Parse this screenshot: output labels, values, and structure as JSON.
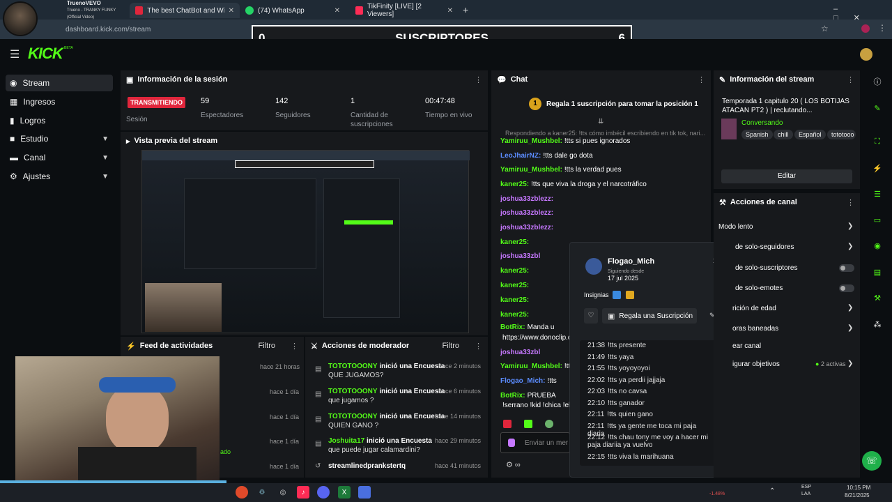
{
  "browser": {
    "tabs": [
      {
        "label": "TruenoVEVO",
        "sub": "Trueno - TRANKY FUNKY (Official Video)"
      },
      {
        "label": "The best ChatBot and Widgets"
      },
      {
        "label": "(74) WhatsApp"
      },
      {
        "label": "TikFinity [LIVE] [2 Viewers]"
      }
    ],
    "url": "dashboard.kick.com/stream"
  },
  "overlay": {
    "left": "0",
    "title": "SUSCRIPTORES",
    "right": "6"
  },
  "kick": {
    "logo": "KICK",
    "beta": "BETA"
  },
  "sidebar": {
    "items": [
      {
        "label": "Stream"
      },
      {
        "label": "Ingresos"
      },
      {
        "label": "Logros"
      },
      {
        "label": "Estudio"
      },
      {
        "label": "Canal"
      },
      {
        "label": "Ajustes"
      }
    ]
  },
  "session": {
    "title": "Información de la sesión",
    "live_badge": "TRANSMITIENDO",
    "session_label": "Sesión",
    "stats": [
      {
        "value": "59",
        "label": "Espectadores"
      },
      {
        "value": "142",
        "label": "Seguidores"
      },
      {
        "value": "1",
        "label": "Cantidad de suscripciones"
      },
      {
        "value": "00:47:48",
        "label": "Tiempo en vivo"
      }
    ]
  },
  "preview": {
    "title": "Vista previa del stream"
  },
  "feed": {
    "title": "Feed de actividades",
    "filter": "Filtro",
    "times": [
      "hace 21 horas",
      "hace 1 día",
      "hace 1 día",
      "hace 1 día",
      "hace 1 día"
    ],
    "partial": "ado"
  },
  "mod": {
    "title": "Acciones de moderador",
    "filter": "Filtro",
    "rows": [
      {
        "user": "TOTOTOOONY",
        "action": "inició una Encuesta",
        "sub": "QUE JUGAMOS?",
        "time": "hace 2 minutos"
      },
      {
        "user": "TOTOTOOONY",
        "action": "inició una Encuesta",
        "sub": "que jugamos ?",
        "time": "hace 6 minutos"
      },
      {
        "user": "TOTOTOOONY",
        "action": "inició una Encuesta",
        "sub": "QUIEN GANO ?",
        "time": "hace 14 minutos"
      },
      {
        "user": "Joshuita17",
        "action": "inició una Encuesta",
        "sub": "que puede jugar calamardini?",
        "time": "hace 29 minutos"
      },
      {
        "user": "streamlinedprankstertq",
        "action": "",
        "sub": "",
        "time": "hace 41 minutos"
      }
    ]
  },
  "chat": {
    "title": "Chat",
    "pinned": "Regala 1 suscripción para tomar la posición 1",
    "pinned_num": "1",
    "reply": "Respondiendo a kaner25: !tts cómo imbécil escribiendo en tik tok, nari...",
    "messages": [
      {
        "user": "Yamiruu_Mushbel:",
        "text": "!tts si pues ignorados",
        "color": "#53fc18"
      },
      {
        "user": "LeoJhairNZ:",
        "text": "!tts dale go dota",
        "color": "#5b8cff"
      },
      {
        "user": "Yamiruu_Mushbel:",
        "text": "!tts la verdad pues",
        "color": "#53fc18"
      },
      {
        "user": "kaner25:",
        "text": "!tts que viva la droga y el narcotráfico",
        "color": "#53fc18"
      },
      {
        "user": "joshua33zblezz:",
        "text": "",
        "color": "#c678ff"
      },
      {
        "user": "joshua33zblezz:",
        "text": "",
        "color": "#c678ff"
      },
      {
        "user": "joshua33zblezz:",
        "text": "",
        "color": "#c678ff"
      },
      {
        "user": "kaner25:",
        "text": "",
        "color": "#53fc18"
      },
      {
        "user": "joshua33zbl",
        "text": "",
        "color": "#c678ff"
      },
      {
        "user": "kaner25:",
        "text": "",
        "color": "#53fc18"
      },
      {
        "user": "kaner25:",
        "text": "",
        "color": "#53fc18"
      },
      {
        "user": "kaner25:",
        "text": "",
        "color": "#53fc18"
      },
      {
        "user": "kaner25:",
        "text": "",
        "color": "#53fc18"
      },
      {
        "user": "BotRix:",
        "text": "Manda u",
        "color": "#53fc18"
      },
      {
        "user": "",
        "text": "https://www.donoclip.c",
        "color": "#ffffff"
      },
      {
        "user": "joshua33zbl",
        "text": "",
        "color": "#c678ff"
      },
      {
        "user": "Yamiruu_Mushbel:",
        "text": "!tts y",
        "color": "#53fc18"
      },
      {
        "user": "Flogao_Mich:",
        "text": "!tts",
        "color": "#5b8cff"
      },
      {
        "user": "BotRix:",
        "text": "PRUEBA",
        "color": "#53fc18"
      },
      {
        "user": "",
        "text": "!serrano !kid !chica !el",
        "color": "#ffffff"
      }
    ],
    "input_placeholder": "Enviar un mensaje"
  },
  "popup": {
    "name": "Flogao_Mich",
    "following_label": "Siguiendo desde",
    "following_date": "17 jul 2025",
    "badges_label": "Insignias",
    "gift_button": "Regala una Suscripción",
    "history": [
      {
        "time": "21:38",
        "text": "!tts presente"
      },
      {
        "time": "21:49",
        "text": "!tts yaya"
      },
      {
        "time": "21:55",
        "text": "!tts yoyoyoyoi"
      },
      {
        "time": "22:02",
        "text": "!tts ya perdii jajjaja"
      },
      {
        "time": "22:03",
        "text": "!tts no cavsa"
      },
      {
        "time": "22:10",
        "text": "!tts ganador"
      },
      {
        "time": "22:11",
        "text": "!tts quien gano"
      },
      {
        "time": "22:11",
        "text": "!tts ya gente me toca mi paja diaria"
      },
      {
        "time": "22:12",
        "text": "!tts chau tony me voy a hacer mi paja diariia ya vuelvo"
      },
      {
        "time": "22:15",
        "text": "!tts viva la marihuana"
      }
    ]
  },
  "stream_info": {
    "title": "Información del stream",
    "stream_title": "Temporada 1 capitulo 20 ( LOS BOTIJAS ATACAN PT2 ) | reclutando...",
    "category": "Conversando",
    "tags": [
      "Spanish",
      "chill",
      "Español",
      "tototooo"
    ],
    "edit": "Editar"
  },
  "channel_actions": {
    "title": "Acciones de canal",
    "items": [
      {
        "label": "Modo lento"
      },
      {
        "label": "de solo-seguidores"
      },
      {
        "label": "de solo-suscriptores"
      },
      {
        "label": "de solo-emotes"
      },
      {
        "label": "rición de edad"
      },
      {
        "label": "oras baneadas"
      },
      {
        "label": "ear canal"
      },
      {
        "label": "igurar objetivos"
      }
    ],
    "active_count": "2 activas"
  },
  "taskbar": {
    "stock": "-1.48%",
    "lang": "ESP",
    "lang2": "LAA",
    "time": "10:15 PM",
    "date": "8/21/2025"
  },
  "colors": {
    "accent": "#53fc18",
    "live": "#e0263c",
    "panel": "#17191c",
    "bg": "#0b0e11"
  }
}
